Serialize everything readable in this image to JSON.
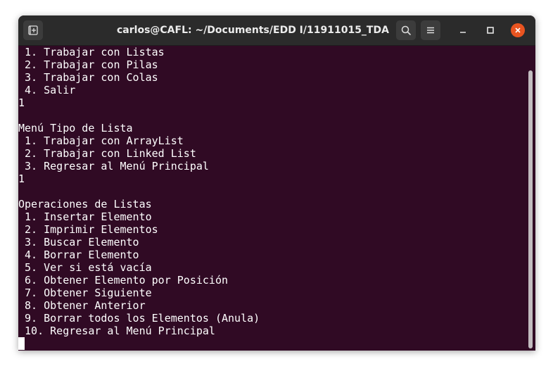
{
  "window": {
    "title": "carlos@CAFL: ~/Documents/EDD I/11911015_TDA"
  },
  "titlebar_icons": {
    "new_tab": "new-tab-icon",
    "search": "search-icon",
    "menu": "hamburger-menu-icon",
    "minimize": "minimize-icon",
    "maximize": "maximize-icon",
    "close": "close-icon"
  },
  "colors": {
    "terminal_bg": "#300a24",
    "titlebar_bg": "#2b2b2b",
    "close_accent": "#e95420",
    "text": "#ffffff"
  },
  "terminal": {
    "lines": [
      " 1. Trabajar con Listas",
      " 2. Trabajar con Pilas",
      " 3. Trabajar con Colas",
      " 4. Salir",
      "1",
      "",
      "Menú Tipo de Lista",
      " 1. Trabajar con ArrayList",
      " 2. Trabajar con Linked List",
      " 3. Regresar al Menú Principal",
      "1",
      "",
      "Operaciones de Listas",
      " 1. Insertar Elemento",
      " 2. Imprimir Elementos",
      " 3. Buscar Elemento",
      " 4. Borrar Elemento",
      " 5. Ver si está vacía",
      " 6. Obtener Elemento por Posición",
      " 7. Obtener Siguiente",
      " 8. Obtener Anterior",
      " 9. Borrar todos los Elementos (Anula)",
      " 10. Regresar al Menú Principal"
    ]
  }
}
